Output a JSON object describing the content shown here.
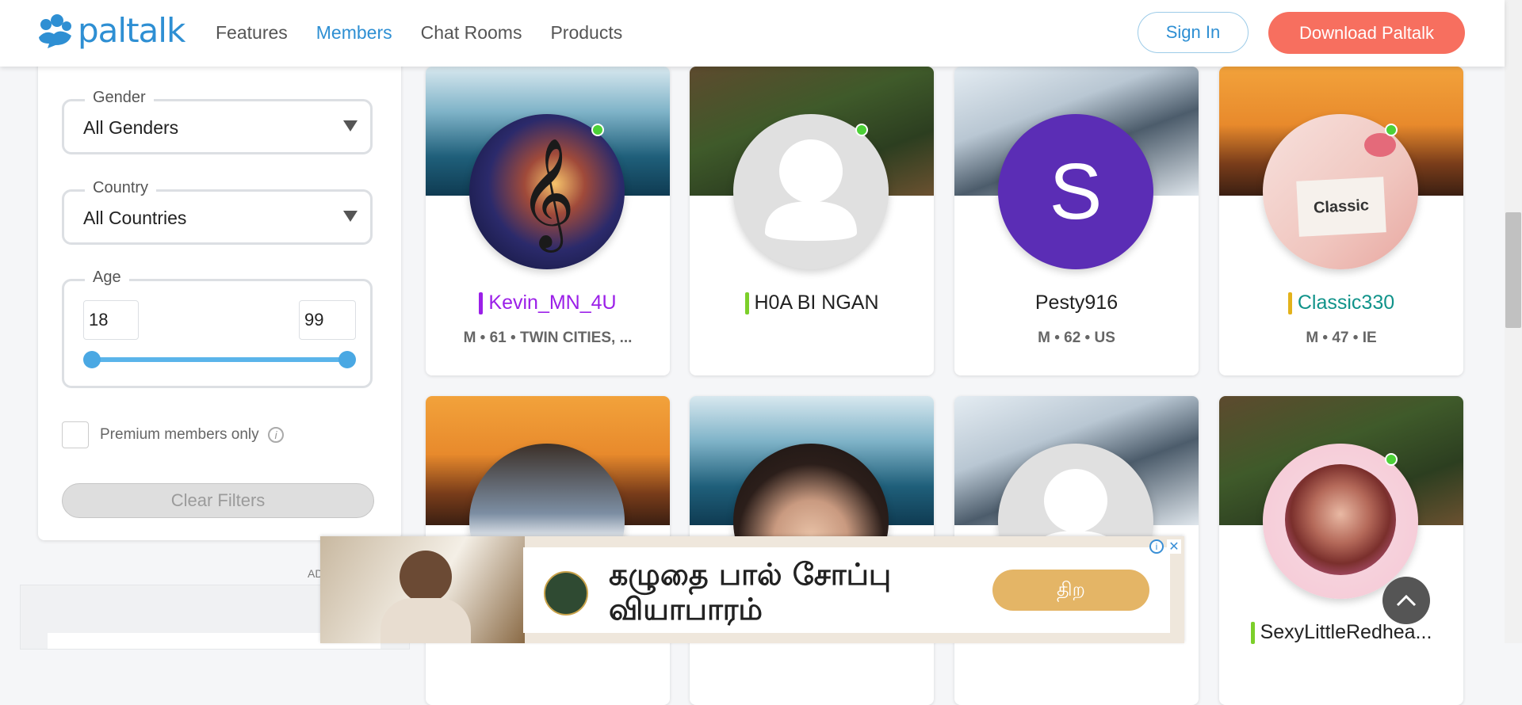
{
  "header": {
    "logo": "paltalk",
    "nav": [
      "Features",
      "Members",
      "Chat Rooms",
      "Products"
    ],
    "active_nav": "Members",
    "sign_in": "Sign In",
    "download": "Download Paltalk"
  },
  "filters": {
    "gender": {
      "legend": "Gender",
      "value": "All Genders"
    },
    "country": {
      "legend": "Country",
      "value": "All Countries"
    },
    "age": {
      "legend": "Age",
      "min": "18",
      "max": "99"
    },
    "premium_label": "Premium members only",
    "clear_label": "Clear Filters",
    "ad_label": "AD"
  },
  "members": [
    {
      "name": "Kevin_MN_4U",
      "details": "M • 61 • TWIN CITIES, ...",
      "name_color": "#9b1fe8",
      "bar_color": "#9b1fe8",
      "online": true,
      "avatar": "music-icon"
    },
    {
      "name": "H0A BI NGAN",
      "details": "",
      "name_color": "#222222",
      "bar_color": "#7ccf2a",
      "online": true,
      "avatar": "default-user-icon"
    },
    {
      "name": "Pesty916",
      "details": "M • 62 • US",
      "name_color": "#222222",
      "bar_color": "",
      "online": false,
      "avatar": "letter",
      "avatar_letter": "S",
      "avatar_color": "#5b2db5"
    },
    {
      "name": "Classic330",
      "details": "M • 47 • IE",
      "name_color": "#10938a",
      "bar_color": "#e3b21b",
      "online": true,
      "avatar": "photo",
      "avatar_text": "Classic"
    },
    {
      "name": "",
      "details": "",
      "online": false,
      "avatar": "photo"
    },
    {
      "name": "",
      "details": "",
      "online": false,
      "avatar": "photo"
    },
    {
      "name": "",
      "details": "",
      "online": false,
      "avatar": "default-user-icon"
    },
    {
      "name": "SexyLittleRedhea...",
      "details": "",
      "name_color": "#222222",
      "bar_color": "#7ccf2a",
      "online": true,
      "avatar": "photo"
    }
  ],
  "ad": {
    "text_line1": "கழுதை பால் சோப்பு",
    "text_line2": "வியாபாரம்",
    "cta": "திற"
  },
  "colors": {
    "brand": "#2e8fd3",
    "download": "#f76f5f",
    "online": "#4cd137"
  }
}
